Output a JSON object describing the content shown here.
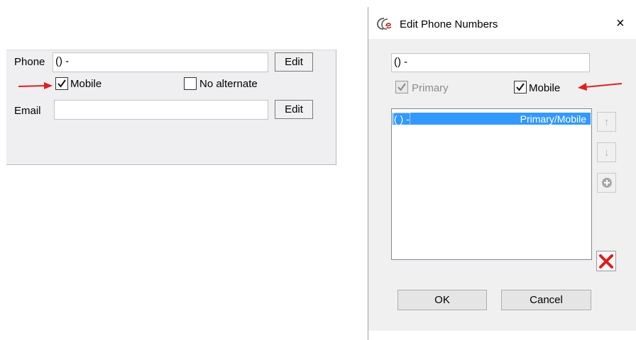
{
  "contact_panel": {
    "phone_label": "Phone",
    "phone_value": "() -",
    "phone_edit_label": "Edit",
    "mobile_label": "Mobile",
    "mobile_checked": true,
    "no_alternate_label": "No alternate",
    "no_alternate_checked": false,
    "email_label": "Email",
    "email_value": "",
    "email_edit_label": "Edit"
  },
  "dialog": {
    "title": "Edit Phone Numbers",
    "close_glyph": "×",
    "number_value": "() -",
    "primary_label": "Primary",
    "primary_checked": true,
    "primary_enabled": false,
    "mobile_label": "Mobile",
    "mobile_checked": true,
    "list": {
      "items": [
        {
          "number": "( ) -",
          "tags": "Primary/Mobile",
          "selected": true
        }
      ]
    },
    "move_up_glyph": "↑",
    "move_down_glyph": "↓",
    "ok_label": "OK",
    "cancel_label": "Cancel"
  },
  "colors": {
    "selection": "#3399ff",
    "annotation_arrow": "#e02020",
    "delete_icon": "#d81e1e",
    "panel_bg": "#efeff2",
    "dialog_bg": "#f0f0f0"
  }
}
